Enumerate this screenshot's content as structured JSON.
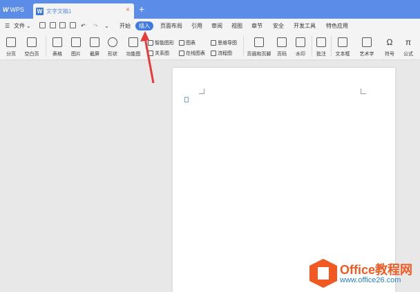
{
  "titlebar": {
    "app_label": "WPS",
    "doc_tab": "文字文稿1",
    "close_glyph": "×",
    "new_tab_glyph": "+"
  },
  "menubar": {
    "file_label": "文件",
    "tabs": [
      "开始",
      "插入",
      "页面布局",
      "引用",
      "审阅",
      "视图",
      "章节",
      "安全",
      "开发工具",
      "特色应用"
    ],
    "active_tab": "插入"
  },
  "ribbon": {
    "big_buttons": [
      "分页",
      "空白页",
      "表格",
      "图片",
      "截屏",
      "形状",
      "功能图"
    ],
    "small_group1": [
      "智能图形",
      "关系图"
    ],
    "small_group2": [
      "图表",
      "在线图表"
    ],
    "small_group3": [
      "思维导图",
      "流程图"
    ],
    "big_buttons2": [
      "页眉和页脚",
      "页码",
      "水印",
      "批注",
      "文本框",
      "艺术字",
      "符号",
      "公式"
    ]
  },
  "watermark": {
    "brand": "Office教程网",
    "url": "www.office26.com"
  },
  "colors": {
    "accent": "#5b8ce8",
    "active_tab": "#3f7ae3",
    "arrow": "#e8393a",
    "watermark_orange": "#f05a22",
    "watermark_blue": "#2a7fcf"
  }
}
